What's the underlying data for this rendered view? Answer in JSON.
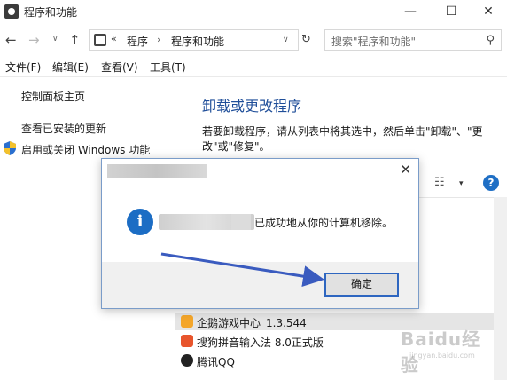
{
  "window": {
    "title": "程序和功能",
    "min_glyph": "—",
    "max_glyph": "☐",
    "close_glyph": "✕"
  },
  "nav": {
    "back_glyph": "←",
    "forward_glyph": "→",
    "dropdown_glyph": "∨",
    "up_glyph": "↑",
    "refresh_glyph": "↻",
    "address_prefix": "«",
    "crumbs": [
      "程序",
      "程序和功能"
    ],
    "crumb_sep": "›",
    "address_drop_glyph": "∨",
    "search_placeholder": "搜索\"程序和功能\"",
    "search_glyph": "⚲"
  },
  "menu": {
    "items": [
      "文件(F)",
      "编辑(E)",
      "查看(V)",
      "工具(T)"
    ]
  },
  "left_pane": {
    "links": [
      "控制面板主页",
      "查看已安装的更新",
      "启用或关闭 Windows 功能"
    ]
  },
  "main": {
    "heading": "卸载或更改程序",
    "description": "若要卸载程序，请从列表中将其选中，然后单击\"卸载\"、\"更改\"或\"修复\"。",
    "view_glyph": "☷",
    "view_drop_glyph": "▾",
    "help_glyph": "?"
  },
  "programs": [
    {
      "name": "企鹅游戏中心_1.3.544",
      "color": "#f4a62a",
      "selected": true
    },
    {
      "name": "搜狗拼音输入法 8.0正式版",
      "color": "#e8552c",
      "selected": false
    },
    {
      "name": "腾讯QQ",
      "color": "#222222",
      "selected": false
    }
  ],
  "dialog": {
    "close_glyph": "✕",
    "info_glyph": "i",
    "message_underscore": "_",
    "message": "已成功地从你的计算机移除。",
    "ok_label": "确定"
  },
  "watermark": {
    "text": "Baidu经验",
    "sub": "jingyan.baidu.com"
  },
  "colors": {
    "accent": "#1f4e99",
    "dialog_border": "#7a9cc9",
    "arrow": "#3a5bbf",
    "ok_border": "#2e66c0"
  }
}
